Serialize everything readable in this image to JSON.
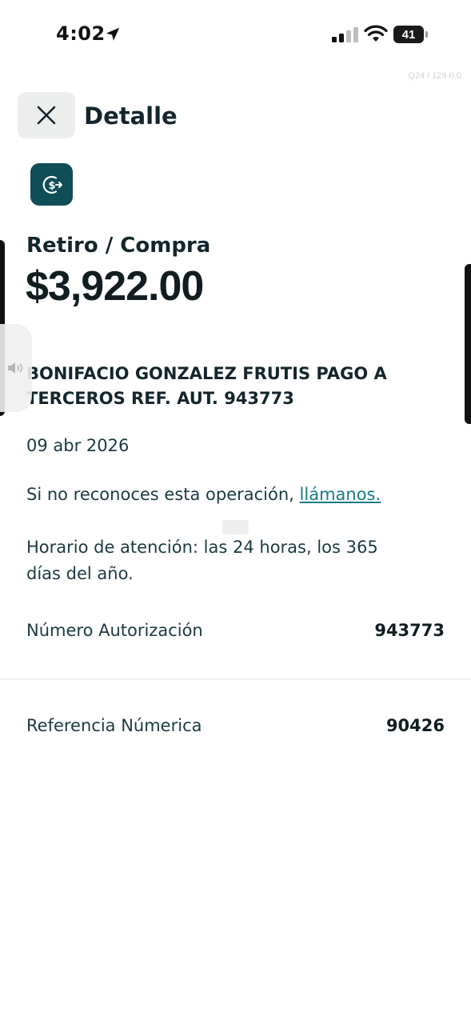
{
  "status_bar": {
    "time": "4:02",
    "battery": "41"
  },
  "version": "Q24 / 129.0.0",
  "header": {
    "title": "Detalle"
  },
  "operation": {
    "type": "Retiro / Compra",
    "amount": "$3,922.00",
    "description": "BONIFACIO GONZALEZ FRUTIS PAGO A TERCEROS REF. AUT. 943773",
    "date": "09 abr 2026",
    "notice_prefix": "Si no reconoces esta operación, ",
    "notice_link": "llámanos.",
    "hours": "Horario de atención: las 24 horas, los 365 días del año."
  },
  "details": [
    {
      "label": "Número Autorización",
      "value": "943773"
    },
    {
      "label": "Referencia Númerica",
      "value": "90426"
    }
  ],
  "colors": {
    "accent": "#0f4d57",
    "link": "#177c86",
    "text": "#14262b"
  }
}
